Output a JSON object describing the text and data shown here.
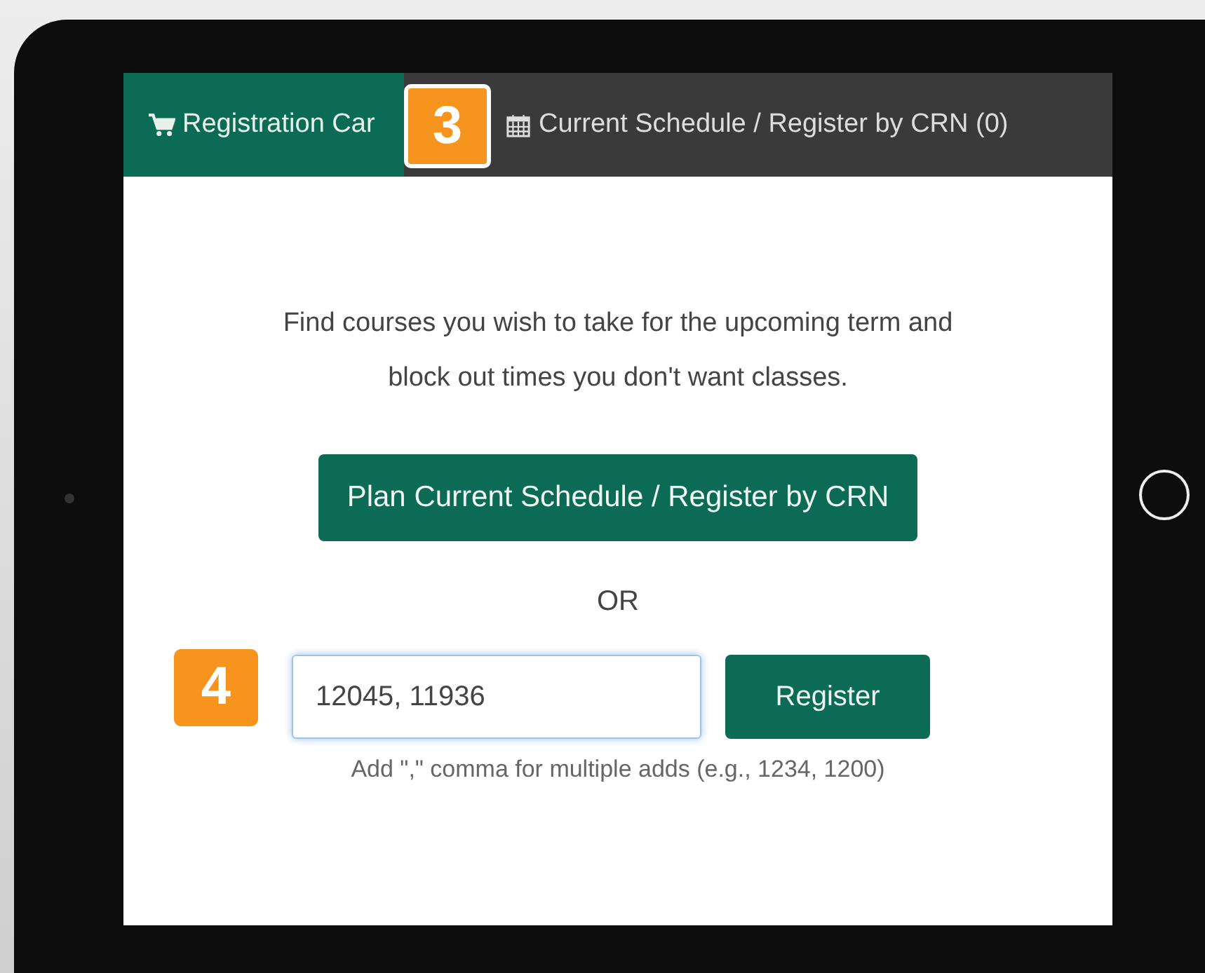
{
  "tabs": [
    {
      "label": "Registration Car",
      "selected": true
    },
    {
      "label": "Current Schedule / Register by CRN (0)",
      "selected": false
    }
  ],
  "tabs_callout": "3",
  "field_callout": "4",
  "description": "Find courses you wish to take for the upcoming term and block out times you don't want classes.",
  "plan_button": "Plan Current Schedule / Register by CRN",
  "separator": "OR",
  "crn_field": {
    "value": "12045, 11936"
  },
  "register_button": "Register",
  "hint": "Add \",\" comma for multiple adds (e.g., 1234, 1200)"
}
